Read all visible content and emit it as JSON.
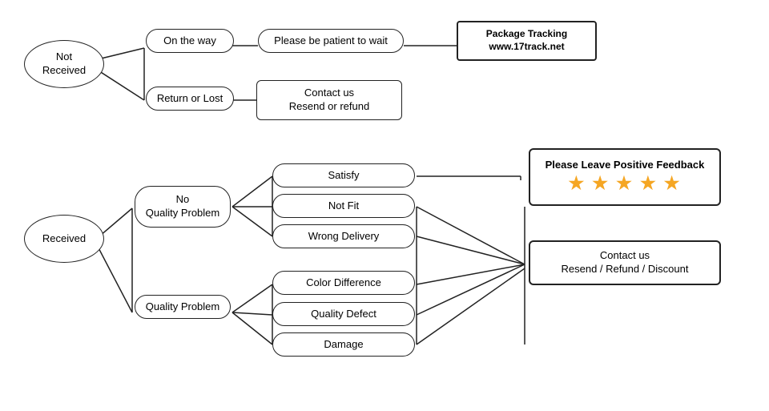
{
  "nodes": {
    "not_received": {
      "label": "Not\nReceived"
    },
    "on_the_way": {
      "label": "On the way"
    },
    "patient": {
      "label": "Please be patient to wait"
    },
    "package_tracking": {
      "label": "Package Tracking\nwww.17track.net"
    },
    "return_or_lost": {
      "label": "Return or Lost"
    },
    "contact_resend": {
      "label": "Contact us\nResend or refund"
    },
    "received": {
      "label": "Received"
    },
    "no_quality": {
      "label": "No\nQuality Problem"
    },
    "satisfy": {
      "label": "Satisfy"
    },
    "not_fit": {
      "label": "Not Fit"
    },
    "wrong_delivery": {
      "label": "Wrong Delivery"
    },
    "quality_problem": {
      "label": "Quality Problem"
    },
    "color_diff": {
      "label": "Color Difference"
    },
    "quality_defect": {
      "label": "Quality Defect"
    },
    "damage": {
      "label": "Damage"
    },
    "feedback": {
      "label": "Please Leave Positive Feedback",
      "stars": "★ ★ ★ ★ ★"
    },
    "contact_refund": {
      "label": "Contact us\nResend / Refund / Discount"
    }
  }
}
